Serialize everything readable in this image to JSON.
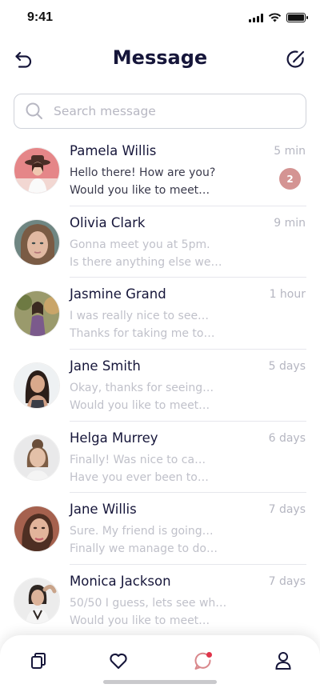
{
  "status_bar": {
    "time": "9:41"
  },
  "header": {
    "title": "Message"
  },
  "search": {
    "placeholder": "Search message",
    "value": ""
  },
  "conversations": [
    {
      "name": "Pamela Willis",
      "time": "5 min",
      "line1": "Hello there! How are you?",
      "line2": "Would you like to meet…",
      "unread_count": "2",
      "unread": true
    },
    {
      "name": "Olivia Clark",
      "time": "9 min",
      "line1": "Gonna meet you at 5pm.",
      "line2": "Is there anything else we…",
      "unread": false
    },
    {
      "name": "Jasmine Grand",
      "time": "1 hour",
      "line1": "I was really nice to see…",
      "line2": "Thanks for taking me to…",
      "unread": false
    },
    {
      "name": "Jane Smith",
      "time": "5 days",
      "line1": "Okay, thanks for seeing…",
      "line2": "Would you like to meet…",
      "unread": false
    },
    {
      "name": "Helga Murrey",
      "time": "6 days",
      "line1": "Finally! Was nice to ca…",
      "line2": "Have you ever been to…",
      "unread": false
    },
    {
      "name": "Jane Willis",
      "time": "7 days",
      "line1": "Sure. My friend is going…",
      "line2": "Finally we manage to do…",
      "unread": false
    },
    {
      "name": "Monica Jackson",
      "time": "7 days",
      "line1": "50/50 I guess, lets see wh…",
      "line2": "Would you like to meet…",
      "unread": false
    }
  ],
  "tabs": [
    {
      "icon": "copy-icon",
      "active": false
    },
    {
      "icon": "heart-icon",
      "active": false
    },
    {
      "icon": "chat-icon",
      "active": true
    },
    {
      "icon": "profile-icon",
      "active": false
    }
  ],
  "colors": {
    "title": "#16163a",
    "badge": "#d49493",
    "active_dot": "#e0344a",
    "active_tab": "#d9878b",
    "muted_text": "#c0c1ca"
  }
}
